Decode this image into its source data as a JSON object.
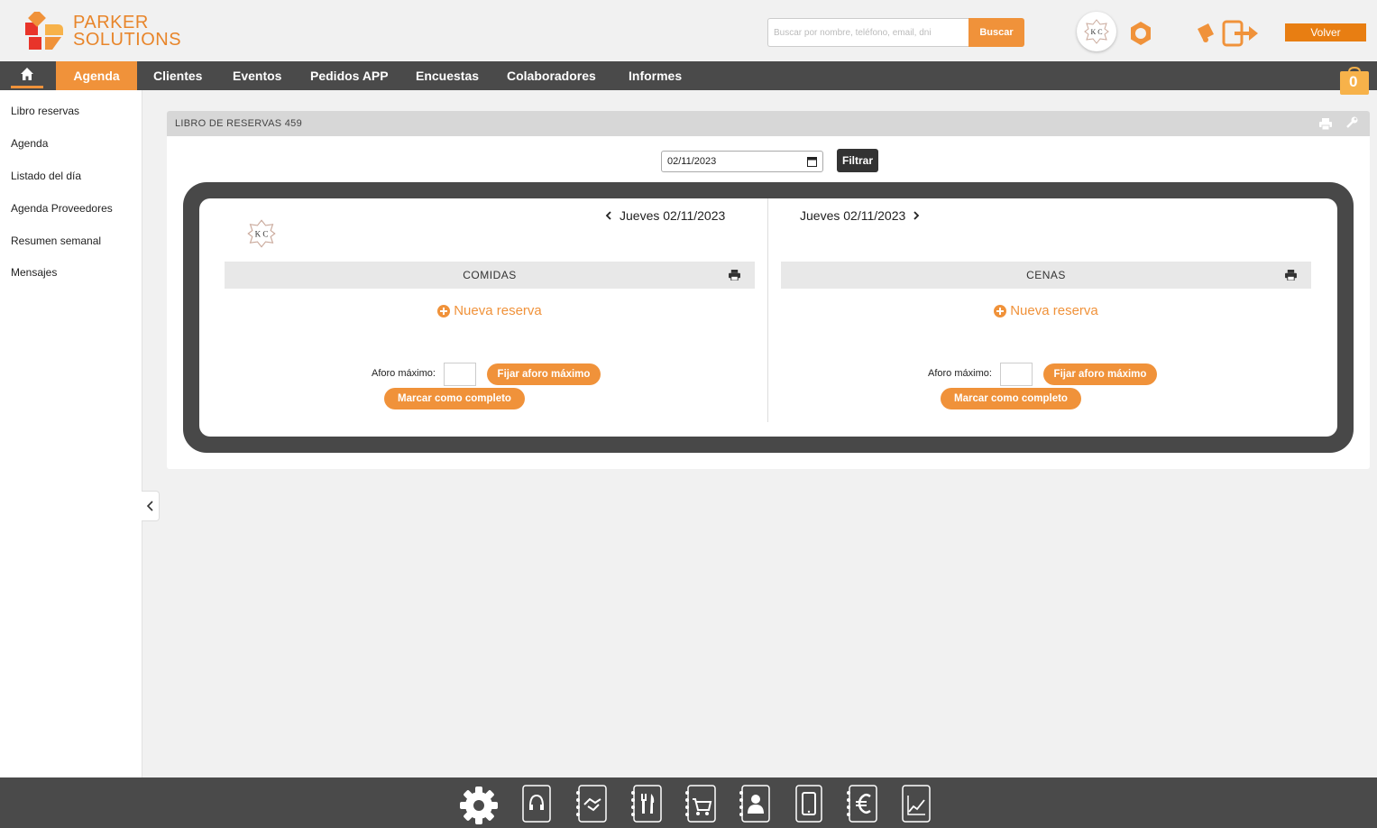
{
  "brand": {
    "line1": "PARKER",
    "line2": "SOLUTIONS",
    "accent": "#f0923a",
    "dark": "#4a4a4a"
  },
  "header": {
    "search_placeholder": "Buscar por nombre, teléfono, email, dni",
    "search_button": "Buscar",
    "avatar_text": "K C",
    "volver": "Volver",
    "icons": [
      "settings-hex-icon",
      "bell-icon",
      "logout-icon"
    ]
  },
  "nav": {
    "home_icon": "home-icon",
    "items": [
      "Agenda",
      "Clientes",
      "Eventos",
      "Pedidos APP",
      "Encuestas",
      "Colaboradores",
      "Informes"
    ],
    "active": "Agenda",
    "cart_count": "0"
  },
  "sidebar": {
    "items": [
      "Libro reservas",
      "Agenda",
      "Listado del día",
      "Agenda Proveedores",
      "Resumen semanal",
      "Mensajes"
    ]
  },
  "panel": {
    "title": "LIBRO DE RESERVAS 459",
    "date_value": "02/11/2023",
    "filter_button": "Filtrar",
    "left_day": "Jueves 02/11/2023",
    "right_day": "Jueves 02/11/2023",
    "logo_text": "K C",
    "columns": [
      {
        "title": "COMIDAS",
        "new_reservation": "Nueva reserva",
        "aforo_label": "Aforo máximo:",
        "set_aforo": "Fijar aforo máximo",
        "mark_complete": "Marcar como completo"
      },
      {
        "title": "CENAS",
        "new_reservation": "Nueva reserva",
        "aforo_label": "Aforo máximo:",
        "set_aforo": "Fijar aforo máximo",
        "mark_complete": "Marcar como completo"
      }
    ]
  },
  "footer": {
    "icons": [
      "settings-gear-icon",
      "headset-icon",
      "handshake-icon",
      "restaurant-icon",
      "cart-icon",
      "contacts-icon",
      "mobile-icon",
      "euro-icon",
      "chart-icon"
    ]
  }
}
